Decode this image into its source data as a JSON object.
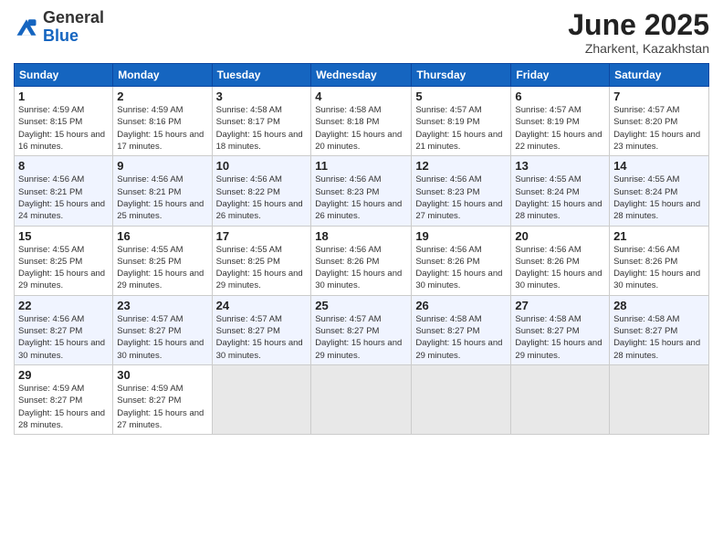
{
  "header": {
    "logo_general": "General",
    "logo_blue": "Blue",
    "month_title": "June 2025",
    "location": "Zharkent, Kazakhstan"
  },
  "weekdays": [
    "Sunday",
    "Monday",
    "Tuesday",
    "Wednesday",
    "Thursday",
    "Friday",
    "Saturday"
  ],
  "weeks": [
    [
      {
        "day": "1",
        "sunrise": "Sunrise: 4:59 AM",
        "sunset": "Sunset: 8:15 PM",
        "daylight": "Daylight: 15 hours and 16 minutes."
      },
      {
        "day": "2",
        "sunrise": "Sunrise: 4:59 AM",
        "sunset": "Sunset: 8:16 PM",
        "daylight": "Daylight: 15 hours and 17 minutes."
      },
      {
        "day": "3",
        "sunrise": "Sunrise: 4:58 AM",
        "sunset": "Sunset: 8:17 PM",
        "daylight": "Daylight: 15 hours and 18 minutes."
      },
      {
        "day": "4",
        "sunrise": "Sunrise: 4:58 AM",
        "sunset": "Sunset: 8:18 PM",
        "daylight": "Daylight: 15 hours and 20 minutes."
      },
      {
        "day": "5",
        "sunrise": "Sunrise: 4:57 AM",
        "sunset": "Sunset: 8:19 PM",
        "daylight": "Daylight: 15 hours and 21 minutes."
      },
      {
        "day": "6",
        "sunrise": "Sunrise: 4:57 AM",
        "sunset": "Sunset: 8:19 PM",
        "daylight": "Daylight: 15 hours and 22 minutes."
      },
      {
        "day": "7",
        "sunrise": "Sunrise: 4:57 AM",
        "sunset": "Sunset: 8:20 PM",
        "daylight": "Daylight: 15 hours and 23 minutes."
      }
    ],
    [
      {
        "day": "8",
        "sunrise": "Sunrise: 4:56 AM",
        "sunset": "Sunset: 8:21 PM",
        "daylight": "Daylight: 15 hours and 24 minutes."
      },
      {
        "day": "9",
        "sunrise": "Sunrise: 4:56 AM",
        "sunset": "Sunset: 8:21 PM",
        "daylight": "Daylight: 15 hours and 25 minutes."
      },
      {
        "day": "10",
        "sunrise": "Sunrise: 4:56 AM",
        "sunset": "Sunset: 8:22 PM",
        "daylight": "Daylight: 15 hours and 26 minutes."
      },
      {
        "day": "11",
        "sunrise": "Sunrise: 4:56 AM",
        "sunset": "Sunset: 8:23 PM",
        "daylight": "Daylight: 15 hours and 26 minutes."
      },
      {
        "day": "12",
        "sunrise": "Sunrise: 4:56 AM",
        "sunset": "Sunset: 8:23 PM",
        "daylight": "Daylight: 15 hours and 27 minutes."
      },
      {
        "day": "13",
        "sunrise": "Sunrise: 4:55 AM",
        "sunset": "Sunset: 8:24 PM",
        "daylight": "Daylight: 15 hours and 28 minutes."
      },
      {
        "day": "14",
        "sunrise": "Sunrise: 4:55 AM",
        "sunset": "Sunset: 8:24 PM",
        "daylight": "Daylight: 15 hours and 28 minutes."
      }
    ],
    [
      {
        "day": "15",
        "sunrise": "Sunrise: 4:55 AM",
        "sunset": "Sunset: 8:25 PM",
        "daylight": "Daylight: 15 hours and 29 minutes."
      },
      {
        "day": "16",
        "sunrise": "Sunrise: 4:55 AM",
        "sunset": "Sunset: 8:25 PM",
        "daylight": "Daylight: 15 hours and 29 minutes."
      },
      {
        "day": "17",
        "sunrise": "Sunrise: 4:55 AM",
        "sunset": "Sunset: 8:25 PM",
        "daylight": "Daylight: 15 hours and 29 minutes."
      },
      {
        "day": "18",
        "sunrise": "Sunrise: 4:56 AM",
        "sunset": "Sunset: 8:26 PM",
        "daylight": "Daylight: 15 hours and 30 minutes."
      },
      {
        "day": "19",
        "sunrise": "Sunrise: 4:56 AM",
        "sunset": "Sunset: 8:26 PM",
        "daylight": "Daylight: 15 hours and 30 minutes."
      },
      {
        "day": "20",
        "sunrise": "Sunrise: 4:56 AM",
        "sunset": "Sunset: 8:26 PM",
        "daylight": "Daylight: 15 hours and 30 minutes."
      },
      {
        "day": "21",
        "sunrise": "Sunrise: 4:56 AM",
        "sunset": "Sunset: 8:26 PM",
        "daylight": "Daylight: 15 hours and 30 minutes."
      }
    ],
    [
      {
        "day": "22",
        "sunrise": "Sunrise: 4:56 AM",
        "sunset": "Sunset: 8:27 PM",
        "daylight": "Daylight: 15 hours and 30 minutes."
      },
      {
        "day": "23",
        "sunrise": "Sunrise: 4:57 AM",
        "sunset": "Sunset: 8:27 PM",
        "daylight": "Daylight: 15 hours and 30 minutes."
      },
      {
        "day": "24",
        "sunrise": "Sunrise: 4:57 AM",
        "sunset": "Sunset: 8:27 PM",
        "daylight": "Daylight: 15 hours and 30 minutes."
      },
      {
        "day": "25",
        "sunrise": "Sunrise: 4:57 AM",
        "sunset": "Sunset: 8:27 PM",
        "daylight": "Daylight: 15 hours and 29 minutes."
      },
      {
        "day": "26",
        "sunrise": "Sunrise: 4:58 AM",
        "sunset": "Sunset: 8:27 PM",
        "daylight": "Daylight: 15 hours and 29 minutes."
      },
      {
        "day": "27",
        "sunrise": "Sunrise: 4:58 AM",
        "sunset": "Sunset: 8:27 PM",
        "daylight": "Daylight: 15 hours and 29 minutes."
      },
      {
        "day": "28",
        "sunrise": "Sunrise: 4:58 AM",
        "sunset": "Sunset: 8:27 PM",
        "daylight": "Daylight: 15 hours and 28 minutes."
      }
    ],
    [
      {
        "day": "29",
        "sunrise": "Sunrise: 4:59 AM",
        "sunset": "Sunset: 8:27 PM",
        "daylight": "Daylight: 15 hours and 28 minutes."
      },
      {
        "day": "30",
        "sunrise": "Sunrise: 4:59 AM",
        "sunset": "Sunset: 8:27 PM",
        "daylight": "Daylight: 15 hours and 27 minutes."
      },
      null,
      null,
      null,
      null,
      null
    ]
  ]
}
